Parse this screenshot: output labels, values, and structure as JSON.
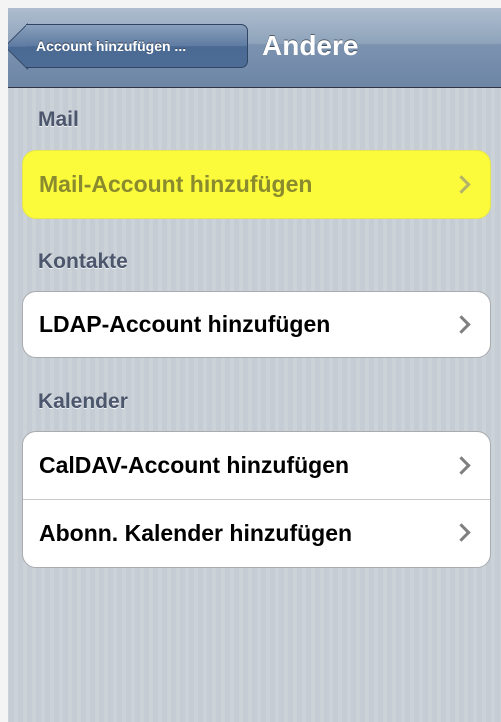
{
  "navbar": {
    "back_label": "Account hinzufügen ...",
    "title": "Andere"
  },
  "sections": [
    {
      "header": "Mail",
      "items": [
        {
          "label": "Mail-Account hinzufügen",
          "highlighted": true
        }
      ]
    },
    {
      "header": "Kontakte",
      "items": [
        {
          "label": "LDAP-Account hinzufügen"
        }
      ]
    },
    {
      "header": "Kalender",
      "items": [
        {
          "label": "CalDAV-Account hinzufügen"
        },
        {
          "label": "Abonn. Kalender hinzufügen"
        }
      ]
    }
  ],
  "colors": {
    "highlight": "#fbfb3c",
    "navbar": "#6d86a5",
    "section_header": "#4c566c"
  },
  "icons": {
    "back": "back-arrow-icon",
    "disclosure": "chevron-right-icon"
  }
}
